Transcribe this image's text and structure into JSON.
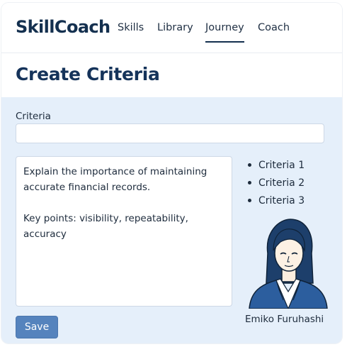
{
  "app": {
    "name": "SkillCoach"
  },
  "nav": {
    "items": [
      {
        "label": "Skills"
      },
      {
        "label": "Library"
      },
      {
        "label": "Journey"
      },
      {
        "label": "Coach"
      }
    ],
    "active": "Journey"
  },
  "page": {
    "title": "Create Criteria"
  },
  "form": {
    "criteria_label": "Criteria",
    "criteria_value": "",
    "description_paragraphs": [
      "Explain the importance of maintaining accurate financial records.",
      "Key points: visibility, repeatability, accuracy"
    ],
    "save_label": "Save"
  },
  "criteria_list": [
    "Criteria 1",
    "Criteria 2",
    "Criteria 3"
  ],
  "coach": {
    "name": "Emiko Furuhashi",
    "avatar_icon": "coach-avatar-illustration"
  },
  "colors": {
    "brand": "#14304f",
    "panel_bg": "#e5effa",
    "button": "#5583bd",
    "avatar_jacket": "#2c5e9e"
  }
}
